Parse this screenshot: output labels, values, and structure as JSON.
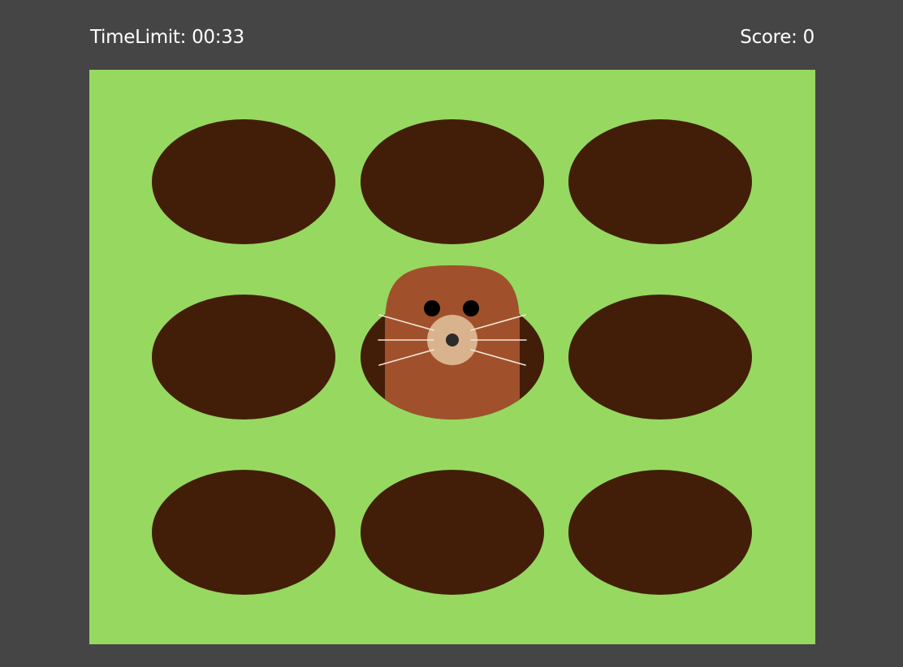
{
  "hud": {
    "timer_label": "TimeLimit:",
    "timer_value": "00:33",
    "score_label": "Score:",
    "score_value": "0"
  },
  "board": {
    "rows": 3,
    "cols": 3,
    "active_hole": 4,
    "holes": [
      {
        "row": 1,
        "col": 1,
        "has_mole": false
      },
      {
        "row": 1,
        "col": 2,
        "has_mole": false
      },
      {
        "row": 1,
        "col": 3,
        "has_mole": false
      },
      {
        "row": 2,
        "col": 1,
        "has_mole": false
      },
      {
        "row": 2,
        "col": 2,
        "has_mole": true
      },
      {
        "row": 2,
        "col": 3,
        "has_mole": false
      },
      {
        "row": 3,
        "col": 1,
        "has_mole": false
      },
      {
        "row": 3,
        "col": 2,
        "has_mole": false
      },
      {
        "row": 3,
        "col": 3,
        "has_mole": false
      }
    ]
  },
  "colors": {
    "background": "#454545",
    "grass": "#97D860",
    "hole": "#421E08",
    "mole_body": "#A0512C",
    "mole_snout": "#D9B38E",
    "mole_eye": "#000000",
    "mole_nose": "#2B2B2B",
    "whisker": "#F2E6DA",
    "hud_text": "#FFFFFF"
  }
}
